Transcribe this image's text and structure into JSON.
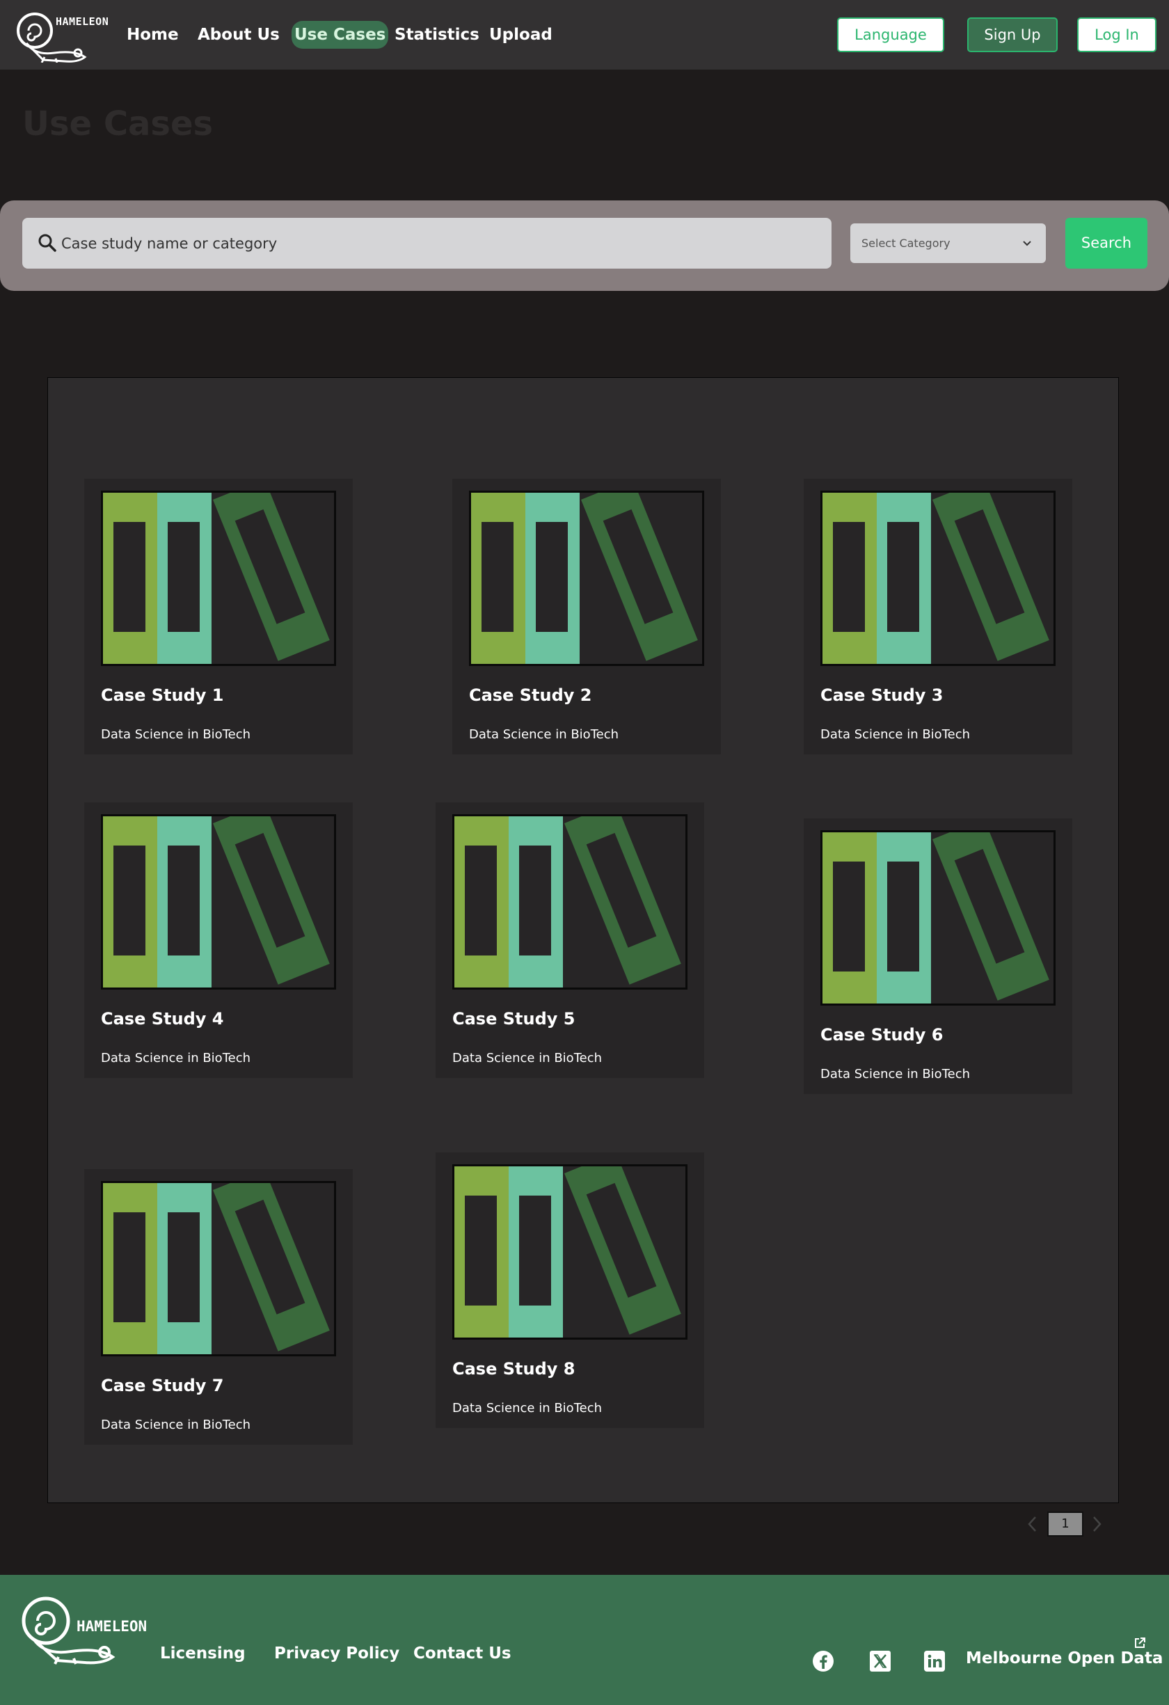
{
  "header": {
    "logo_text": "HAMELEON",
    "nav": [
      {
        "label": "Home",
        "active": false
      },
      {
        "label": "About Us",
        "active": false
      },
      {
        "label": "Use Cases",
        "active": true
      },
      {
        "label": "Statistics",
        "active": false
      },
      {
        "label": "Upload",
        "active": false
      }
    ],
    "buttons": {
      "language": "Language",
      "signup": "Sign Up",
      "login": "Log In"
    }
  },
  "page": {
    "title": "Use Cases"
  },
  "search": {
    "placeholder": "Case study name or category",
    "category_placeholder": "Select Category",
    "button": "Search"
  },
  "cases": [
    {
      "title": "Case Study 1",
      "category": "Data Science in BioTech"
    },
    {
      "title": "Case Study 2",
      "category": "Data Science in BioTech"
    },
    {
      "title": "Case Study 3",
      "category": "Data Science in BioTech"
    },
    {
      "title": "Case Study 4",
      "category": "Data Science in BioTech"
    },
    {
      "title": "Case Study 5",
      "category": "Data Science in BioTech"
    },
    {
      "title": "Case Study 6",
      "category": "Data Science in BioTech"
    },
    {
      "title": "Case Study 7",
      "category": "Data Science in BioTech"
    },
    {
      "title": "Case Study 8",
      "category": "Data Science in BioTech"
    }
  ],
  "pagination": {
    "current": "1"
  },
  "footer": {
    "logo_text": "HAMELEON",
    "links": {
      "licensing": "Licensing",
      "privacy": "Privacy Policy",
      "contact": "Contact Us"
    },
    "social": [
      "facebook-icon",
      "x-twitter-icon",
      "linkedin-icon"
    ],
    "external_link": "Melbourne Open Data"
  },
  "colors": {
    "accent_green": "#2dc674",
    "dark_green": "#3a7150",
    "binder_lime": "#86ac45",
    "binder_teal": "#6cc2a0",
    "binder_olive": "#3a6a3c"
  }
}
